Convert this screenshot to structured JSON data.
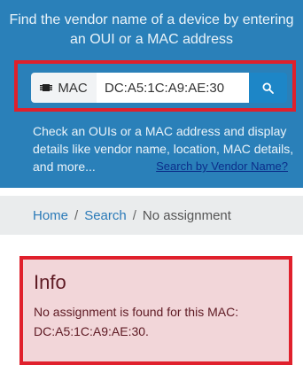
{
  "hero": {
    "tagline": "Find the vendor name of a device by entering an OUI or a MAC address",
    "search": {
      "type_label": "MAC",
      "value": "DC:A5:1C:A9:AE:30",
      "type_icon": "chip-icon",
      "button_icon": "search-icon"
    },
    "description": "Check an OUIs or a MAC address and display details like vendor name, location, MAC details, and more...",
    "vendor_link": "Search by Vendor Name?"
  },
  "breadcrumb": {
    "items": [
      "Home",
      "Search",
      "No assignment"
    ],
    "separator": "/"
  },
  "alert": {
    "title": "Info",
    "message": "No assignment is found for this MAC: DC:A5:1C:A9:AE:30."
  },
  "colors": {
    "hero_bg": "#2a80b9",
    "highlight_border": "#e0202c",
    "alert_bg": "#f2d6d9",
    "alert_text": "#5e1a23",
    "link_dark": "#0b2e8a"
  }
}
